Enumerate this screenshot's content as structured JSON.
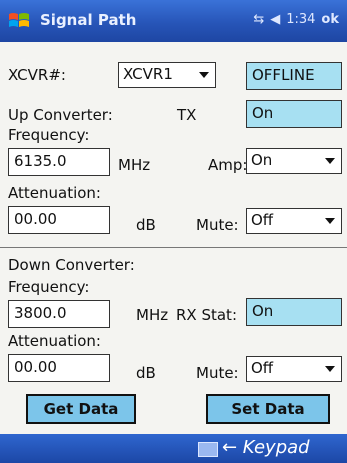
{
  "titlebar": {
    "title": "Signal Path",
    "time": "1:34",
    "ok_label": "ok",
    "icons": [
      "windows-logo-icon",
      "connectivity-icon",
      "volume-icon"
    ]
  },
  "xcvr": {
    "label": "XCVR#:",
    "value": "XCVR1",
    "status": "OFFLINE"
  },
  "up": {
    "title": "Up Converter:",
    "tx_label": "TX",
    "tx_value": "On",
    "freq_label": "Frequency:",
    "freq_value": "6135.0",
    "freq_unit": "MHz",
    "amp_label": "Amp:",
    "amp_value": "On",
    "atten_label": "Attenuation:",
    "atten_value": "00.00",
    "atten_unit": "dB",
    "mute_label": "Mute:",
    "mute_value": "Off"
  },
  "down": {
    "title": "Down Converter:",
    "freq_label": "Frequency:",
    "freq_value": "3800.0",
    "freq_unit": "MHz",
    "rxstat_label": "RX Stat:",
    "rxstat_value": "On",
    "atten_label": "Attenuation:",
    "atten_value": "00.00",
    "atten_unit": "dB",
    "mute_label": "Mute:",
    "mute_value": "Off"
  },
  "buttons": {
    "get": "Get Data",
    "set": "Set Data"
  },
  "taskbar": {
    "keypad_label": "← Keypad"
  },
  "colors": {
    "titlebar": "#2755b8",
    "status_fill": "#a7e0f2",
    "button_fill": "#7cc5ea"
  }
}
